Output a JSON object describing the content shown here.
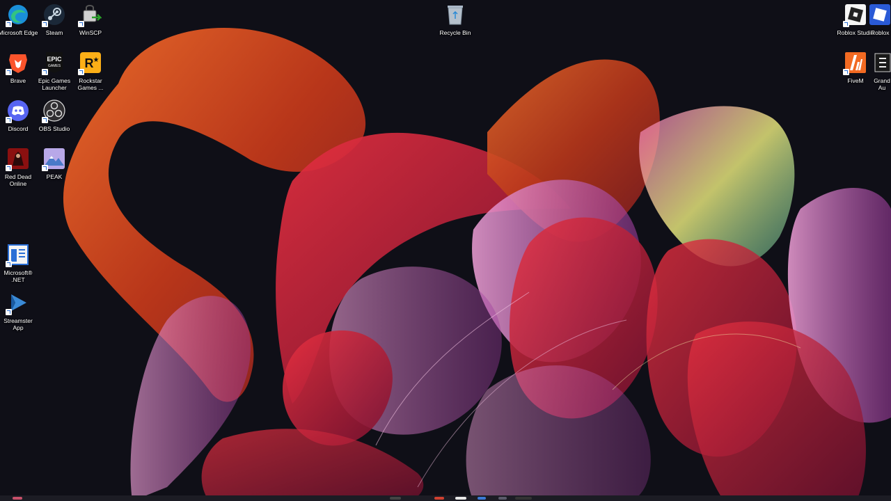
{
  "desktop": {
    "icons": [
      {
        "label": "Microsoft Edge",
        "icon": "edge-icon"
      },
      {
        "label": "Steam",
        "icon": "steam-icon"
      },
      {
        "label": "WinSCP",
        "icon": "winscp-icon"
      },
      {
        "label": "Recycle Bin",
        "icon": "recycle-bin-icon"
      },
      {
        "label": "Roblox Studio",
        "icon": "roblox-studio-icon"
      },
      {
        "label": "Roblox",
        "icon": "roblox-icon"
      },
      {
        "label": "Brave",
        "icon": "brave-icon"
      },
      {
        "label": "Epic Games Launcher",
        "icon": "epic-games-icon"
      },
      {
        "label": "Rockstar Games ...",
        "icon": "rockstar-icon"
      },
      {
        "label": "FiveM",
        "icon": "fivem-icon"
      },
      {
        "label": "Grand Au",
        "icon": "gta-icon"
      },
      {
        "label": "Discord",
        "icon": "discord-icon"
      },
      {
        "label": "OBS Studio",
        "icon": "obs-icon"
      },
      {
        "label": "Red Dead Online",
        "icon": "red-dead-icon"
      },
      {
        "label": "PEAK",
        "icon": "peak-icon"
      },
      {
        "label": "Microsoft® .NET",
        "icon": "dotnet-icon"
      },
      {
        "label": "Streamster App",
        "icon": "streamster-icon"
      }
    ]
  },
  "colors": {
    "background": "#0f0f17",
    "ribbon_orange": "#d4521a",
    "ribbon_red": "#c8182c",
    "ribbon_pink": "#d070c8"
  }
}
